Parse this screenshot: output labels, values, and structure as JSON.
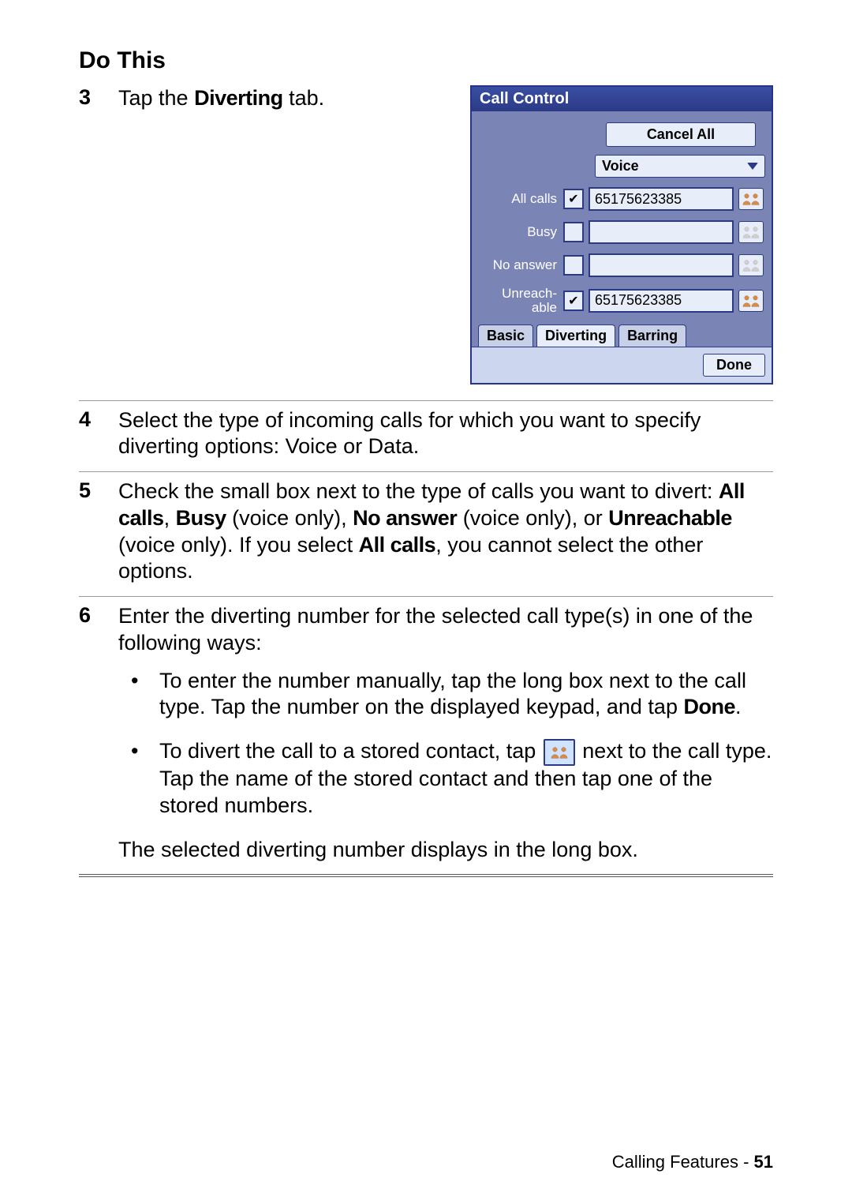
{
  "heading": "Do This",
  "steps": {
    "s3": {
      "num": "3",
      "text_a": "Tap the ",
      "bold": "Diverting",
      "text_b": " tab."
    },
    "s4": {
      "num": "4",
      "text": "Select the type of incoming calls for which you want to specify diverting options: Voice or Data."
    },
    "s5": {
      "num": "5",
      "t1": "Check the small box next to the type of calls you want to divert: ",
      "b1": "All calls",
      "t2": ", ",
      "b2": "Busy",
      "t3": " (voice only), ",
      "b3": "No answer",
      "t4": " (voice only), or ",
      "b4": "Unreachable",
      "t5": " (voice only). If you select ",
      "b5": "All calls",
      "t6": ", you cannot select the other options."
    },
    "s6": {
      "num": "6",
      "intro": "Enter the diverting number for the selected call type(s) in one of the following ways:",
      "bul1_a": "To enter the number manually, tap the long box next to the call type. Tap the number on the displayed keypad, and tap ",
      "bul1_b": "Done",
      "bul1_c": ".",
      "bul2_a": "To divert the call to a stored contact, tap ",
      "bul2_b": " next to the call type. Tap the name of the stored contact and then tap one of the stored numbers.",
      "conclusion": "The selected diverting number displays in the long box."
    }
  },
  "screenshot": {
    "title": "Call Control",
    "cancel": "Cancel All",
    "select_value": "Voice",
    "rows": {
      "allcalls": {
        "label": "All calls",
        "checked": true,
        "value": "65175623385"
      },
      "busy": {
        "label": "Busy",
        "checked": false,
        "value": ""
      },
      "noanswer": {
        "label": "No answer",
        "checked": false,
        "value": ""
      },
      "unreach": {
        "label": "Unreach-\nable",
        "checked": true,
        "value": "65175623385"
      }
    },
    "tabs": {
      "basic": "Basic",
      "diverting": "Diverting",
      "barring": "Barring"
    },
    "done": "Done"
  },
  "footer": {
    "section": "Calling Features - ",
    "page": "51"
  }
}
